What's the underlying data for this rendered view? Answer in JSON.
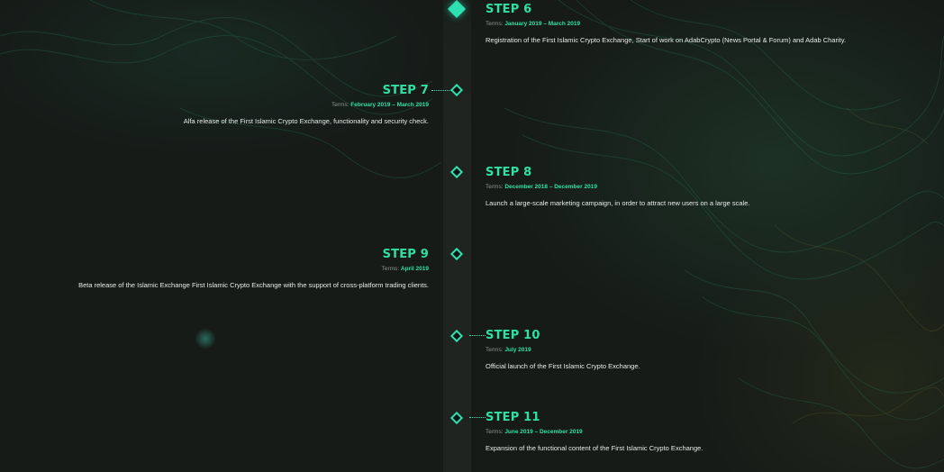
{
  "colors": {
    "accent": "#2fe0a4",
    "background": "#161b18",
    "text": "#e6ece8",
    "muted": "#8a948e"
  },
  "timeline": {
    "terms_label": "Terms:",
    "steps": [
      {
        "title": "STEP 6",
        "dates": "January 2019 – March 2019",
        "description": "Registration of the First Islamic Crypto Exchange, Start of work on AdabCrypto (News Portal & Forum) and Adab Charity.",
        "side": "right",
        "active": true
      },
      {
        "title": "STEP 7",
        "dates": "February 2019 – March 2019",
        "description": "Alfa release of the First Islamic Crypto Exchange, functionality and security check.",
        "side": "left",
        "active": false
      },
      {
        "title": "STEP 8",
        "dates": "December 2018 – December 2019",
        "description": "Launch a large-scale marketing campaign, in order to attract new users on a large scale.",
        "side": "right",
        "active": false
      },
      {
        "title": "STEP 9",
        "dates": "April 2019",
        "description": "Beta release of the Islamic Exchange First Islamic Crypto Exchange with the support of cross-platform trading clients.",
        "side": "left",
        "active": false
      },
      {
        "title": "STEP 10",
        "dates": "July 2019",
        "description": "Official launch of the First Islamic Crypto Exchange.",
        "side": "right",
        "active": false
      },
      {
        "title": "STEP 11",
        "dates": "June 2019 – December 2019",
        "description": "Expansion of the functional content of the First Islamic Crypto Exchange.",
        "side": "right",
        "active": false
      }
    ]
  }
}
